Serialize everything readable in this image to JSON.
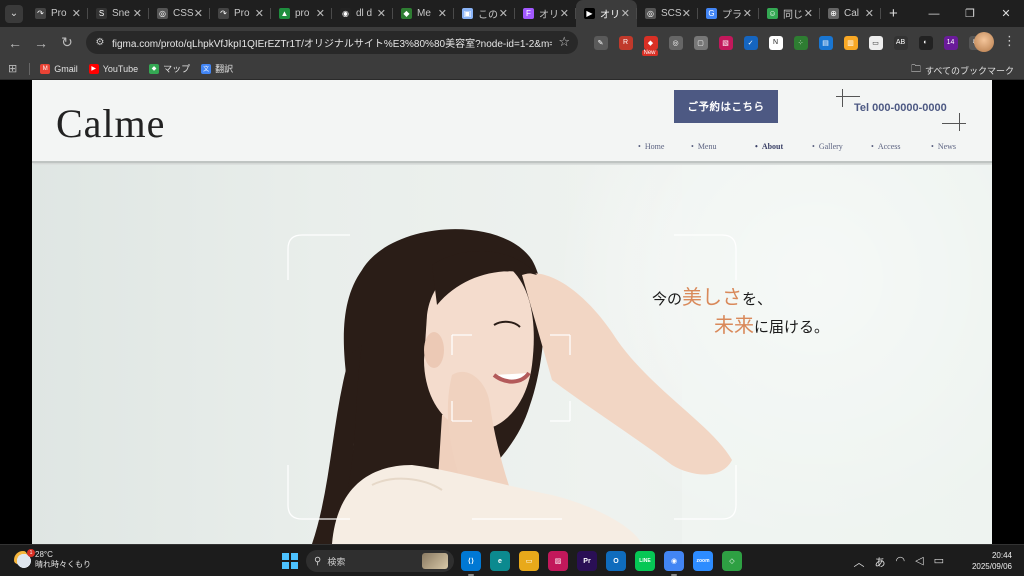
{
  "browser": {
    "tabs": [
      {
        "title": "Pro",
        "fav_color": "#444",
        "glyph": "↷"
      },
      {
        "title": "Sne",
        "fav_color": "#333",
        "glyph": "S"
      },
      {
        "title": "CSS",
        "fav_color": "#555",
        "glyph": "◎"
      },
      {
        "title": "Pro",
        "fav_color": "#444",
        "glyph": "↷"
      },
      {
        "title": "pro",
        "fav_color": "#1e8e3e",
        "glyph": "▲"
      },
      {
        "title": "dl d",
        "fav_color": "#222",
        "glyph": "◉"
      },
      {
        "title": "Me",
        "fav_color": "#2e7d32",
        "glyph": "◆"
      },
      {
        "title": "この",
        "fav_color": "#8ab4f8",
        "glyph": "▣"
      },
      {
        "title": "オリ",
        "fav_color": "#a259ff",
        "glyph": "F"
      },
      {
        "title": "オリ",
        "fav_color": "#000",
        "glyph": "▶"
      },
      {
        "title": "SCS",
        "fav_color": "#555",
        "glyph": "◎"
      },
      {
        "title": "プラ",
        "fav_color": "#4285f4",
        "glyph": "G"
      },
      {
        "title": "同じ",
        "fav_color": "#34a853",
        "glyph": "☺"
      },
      {
        "title": "Cal",
        "fav_color": "#666",
        "glyph": "⊕"
      }
    ],
    "active_tab_index": 9,
    "new_tab": "+",
    "url": "figma.com/proto/qLhpkVfJkpI1QIErEZTr1T/オリジナルサイト%E3%80%80美容室?node-id=1-2&m=draw&sc...",
    "extensions": [
      {
        "name": "eyedropper-ext",
        "color": "#5a5a5a",
        "glyph": "✎"
      },
      {
        "name": "reader-ext",
        "color": "#c0392b",
        "glyph": "R"
      },
      {
        "name": "new-ext",
        "color": "#d93025",
        "glyph": "◆",
        "badge": "New"
      },
      {
        "name": "compass-ext",
        "color": "#666",
        "glyph": "◎"
      },
      {
        "name": "window-ext",
        "color": "#777",
        "glyph": "▢"
      },
      {
        "name": "pink-ext",
        "color": "#c2185b",
        "glyph": "▧"
      },
      {
        "name": "check-ext",
        "color": "#1565c0",
        "glyph": "✓"
      },
      {
        "name": "notion-ext",
        "color": "#fff",
        "glyph": "N"
      },
      {
        "name": "dotted-ext",
        "color": "#2e7d32",
        "glyph": "⁘"
      },
      {
        "name": "photo-ext",
        "color": "#1976d2",
        "glyph": "▤"
      },
      {
        "name": "yellow-ext",
        "color": "#f9a825",
        "glyph": "▥"
      },
      {
        "name": "note-ext",
        "color": "#eee",
        "glyph": "▭"
      },
      {
        "name": "ab-ext",
        "color": "#333",
        "glyph": "AB"
      },
      {
        "name": "circle-ext",
        "color": "#222",
        "glyph": "◐"
      },
      {
        "name": "purple-ext",
        "color": "#6a1b9a",
        "glyph": "14"
      },
      {
        "name": "puzzle-ext",
        "color": "#555",
        "glyph": "⧉"
      }
    ],
    "bookmarks": [
      {
        "label": "Gmail",
        "color": "#ea4335",
        "glyph": "M"
      },
      {
        "label": "YouTube",
        "color": "#ff0000",
        "glyph": "▶"
      },
      {
        "label": "マップ",
        "color": "#34a853",
        "glyph": "◆"
      },
      {
        "label": "翻訳",
        "color": "#4285f4",
        "glyph": "文"
      }
    ],
    "all_bookmarks": "すべてのブックマーク"
  },
  "site": {
    "logo": "Calme",
    "reserve_button": "ご予約はこちら",
    "tel": "Tel 000-0000-0000",
    "nav": [
      "Home",
      "Menu",
      "About",
      "Gallery",
      "Access",
      "News"
    ],
    "nav_current": "About",
    "tagline": {
      "l1_a": "今の",
      "l1_accent": "美しさ",
      "l1_b": "を、",
      "l2_accent": "未来",
      "l2_b": "に届ける。"
    },
    "accent_color": "#d9895a",
    "brand_color": "#4d5983"
  },
  "taskbar": {
    "weather_temp": "28°C",
    "weather_text": "晴れ時々くもり",
    "search_placeholder": "検索",
    "apps": [
      {
        "name": "vscode-app",
        "color": "#0078d4",
        "glyph": "⟨⟩"
      },
      {
        "name": "edge-app",
        "color": "#0c8a8f",
        "glyph": "e"
      },
      {
        "name": "explorer-app",
        "color": "#e8a91a",
        "glyph": "▭"
      },
      {
        "name": "photos-app",
        "color": "#c2185b",
        "glyph": "▨"
      },
      {
        "name": "premiere-app",
        "color": "#2a0f55",
        "glyph": "Pr"
      },
      {
        "name": "outlook-app",
        "color": "#0f6cbd",
        "glyph": "O"
      },
      {
        "name": "line-app",
        "color": "#06c755",
        "glyph": "LINE"
      },
      {
        "name": "chrome-app",
        "color": "#4285f4",
        "glyph": "◉"
      },
      {
        "name": "zoom-app",
        "color": "#2d8cff",
        "glyph": "zoom"
      },
      {
        "name": "copilot-app",
        "color": "#2ea043",
        "glyph": "◇"
      }
    ],
    "ime": "あ",
    "time": "20:44",
    "date": "2025/09/06"
  }
}
